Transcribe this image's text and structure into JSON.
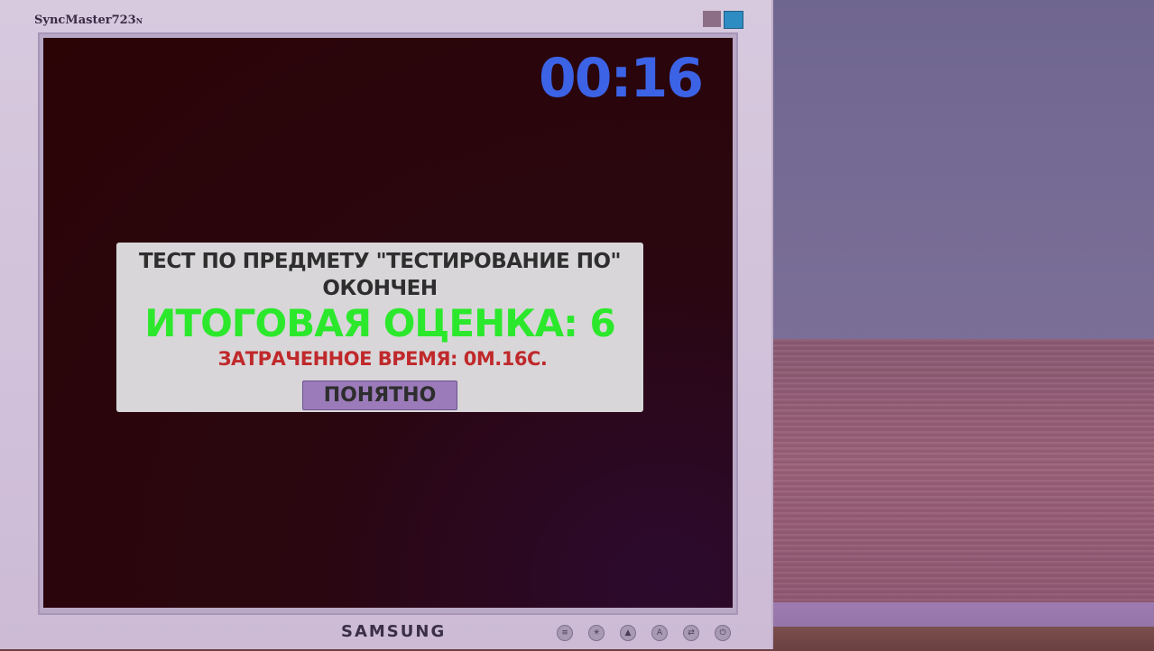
{
  "monitor": {
    "model": "SyncMaster723",
    "model_suffix": "N",
    "brand": "SAMSUNG",
    "controls": [
      {
        "icon": "menu-icon",
        "glyph": "≡"
      },
      {
        "icon": "brightness-icon",
        "glyph": "☀"
      },
      {
        "icon": "adjust-up-icon",
        "glyph": "▲"
      },
      {
        "icon": "auto-icon",
        "glyph": "A"
      },
      {
        "icon": "source-icon",
        "glyph": "⇄"
      },
      {
        "icon": "power-icon",
        "glyph": "⏻"
      }
    ],
    "led_colors": [
      "#8c6f86",
      "#2d8cc2"
    ]
  },
  "screen": {
    "timer": "00:16",
    "timer_color": "#3c63e6"
  },
  "dialog": {
    "title": "ТЕСТ ПО ПРЕДМЕТУ \"ТЕСТИРОВАНИЕ ПО\" ОКОНЧЕН",
    "grade": "ИТОГОВАЯ ОЦЕНКА: 6",
    "time_spent": "ЗАТРАЧЕННОЕ ВРЕМЯ:  0М.16С.",
    "button_label": "ПОНЯТНО",
    "colors": {
      "grade": "#2ce82c",
      "time_spent": "#c0292b",
      "button": "#9b7bb9"
    }
  }
}
